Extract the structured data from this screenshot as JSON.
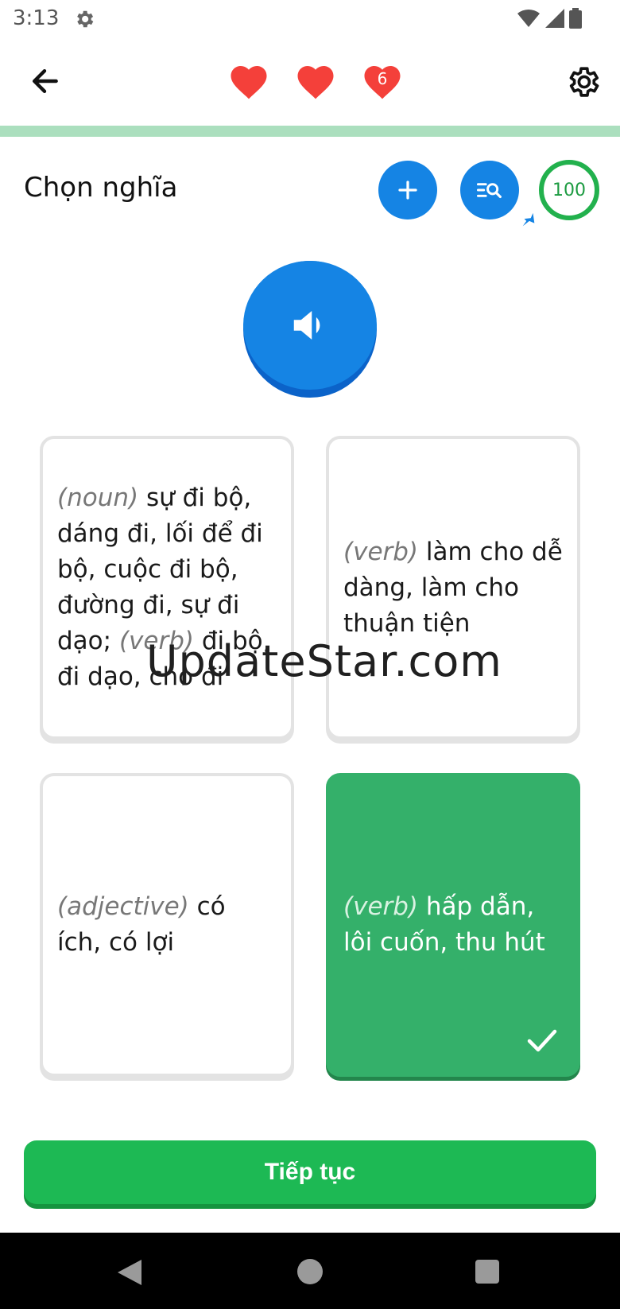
{
  "status_bar": {
    "time": "3:13",
    "icons": [
      "settings-icon",
      "wifi-icon",
      "signal-icon",
      "battery-icon"
    ]
  },
  "header": {
    "back_icon": "arrow-left-icon",
    "hearts": [
      {
        "icon": "heart-icon",
        "count": ""
      },
      {
        "icon": "heart-icon",
        "count": ""
      },
      {
        "icon": "heart-icon",
        "count": "6"
      }
    ],
    "settings_icon": "gear-icon",
    "progress_fraction": 0
  },
  "question": {
    "title": "Chọn nghĩa",
    "add_icon": "plus-icon",
    "lookup_icon": "list-search-icon",
    "score": "100",
    "audio_icon": "speaker-icon"
  },
  "answers": [
    {
      "segments": [
        {
          "pos": "(noun)",
          "text": " sự đi bộ, dáng đi, lối để đi bộ, cuộc đi bộ, đường đi, sự đi dạo; "
        },
        {
          "pos": " (verb)",
          "text": " đi bộ, đi dạo, cho đi"
        }
      ],
      "selected": false
    },
    {
      "segments": [
        {
          "pos": "(verb)",
          "text": " làm cho dễ dàng, làm cho thuận tiện"
        }
      ],
      "selected": false
    },
    {
      "segments": [
        {
          "pos": "(adjective)",
          "text": " có ích, có lợi"
        }
      ],
      "selected": false
    },
    {
      "segments": [
        {
          "pos": "(verb)",
          "text": " hấp dẫn, lôi cuốn, thu hút"
        }
      ],
      "selected": true
    }
  ],
  "watermark": "UpdateStar.com",
  "continue_label": "Tiếp tục",
  "colors": {
    "primary_blue": "#1584e4",
    "heart_red": "#f4403a",
    "correct_green": "#34b06a",
    "button_green": "#1db954",
    "progress_track": "#abdfbe"
  }
}
